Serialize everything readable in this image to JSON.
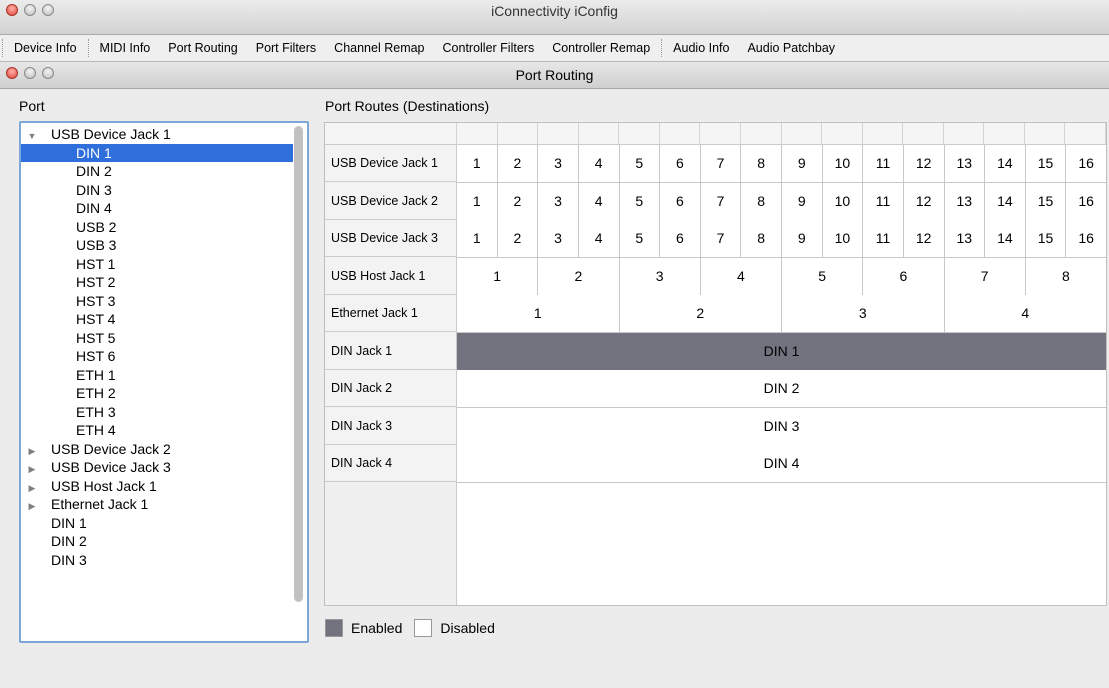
{
  "window": {
    "title": "iConnectivity iConfig"
  },
  "tabs": [
    "Device Info",
    "MIDI Info",
    "Port Routing",
    "Port Filters",
    "Channel Remap",
    "Controller Filters",
    "Controller Remap",
    "Audio Info",
    "Audio Patchbay"
  ],
  "subwindow": {
    "title": "Port Routing"
  },
  "port_panel": {
    "label": "Port",
    "items": [
      {
        "label": "USB Device Jack 1",
        "expand": "open",
        "indent": 0
      },
      {
        "label": "DIN 1",
        "indent": 1,
        "selected": true
      },
      {
        "label": "DIN 2",
        "indent": 1
      },
      {
        "label": "DIN 3",
        "indent": 1
      },
      {
        "label": "DIN 4",
        "indent": 1
      },
      {
        "label": "USB 2",
        "indent": 1
      },
      {
        "label": "USB 3",
        "indent": 1
      },
      {
        "label": "HST 1",
        "indent": 1
      },
      {
        "label": "HST 2",
        "indent": 1
      },
      {
        "label": "HST 3",
        "indent": 1
      },
      {
        "label": "HST 4",
        "indent": 1
      },
      {
        "label": "HST 5",
        "indent": 1
      },
      {
        "label": "HST 6",
        "indent": 1
      },
      {
        "label": "ETH 1",
        "indent": 1
      },
      {
        "label": "ETH 2",
        "indent": 1
      },
      {
        "label": "ETH 3",
        "indent": 1
      },
      {
        "label": "ETH 4",
        "indent": 1
      },
      {
        "label": "USB Device Jack 2",
        "expand": "closed",
        "indent": 0
      },
      {
        "label": "USB Device Jack 3",
        "expand": "closed",
        "indent": 0
      },
      {
        "label": "USB Host Jack 1",
        "expand": "closed",
        "indent": 0
      },
      {
        "label": "Ethernet Jack 1",
        "expand": "closed",
        "indent": 0
      },
      {
        "label": "DIN 1",
        "indent": 0
      },
      {
        "label": "DIN 2",
        "indent": 0
      },
      {
        "label": "DIN 3",
        "indent": 0
      }
    ]
  },
  "routes_panel": {
    "label": "Port Routes (Destinations)",
    "rows": [
      {
        "label": "USB Device Jack 1",
        "cells": [
          "1",
          "2",
          "3",
          "4",
          "5",
          "6",
          "7",
          "8",
          "9",
          "10",
          "11",
          "12",
          "13",
          "14",
          "15",
          "16"
        ],
        "enabled": []
      },
      {
        "label": "USB Device Jack 2",
        "cells": [
          "1",
          "2",
          "3",
          "4",
          "5",
          "6",
          "7",
          "8",
          "9",
          "10",
          "11",
          "12",
          "13",
          "14",
          "15",
          "16"
        ],
        "enabled": []
      },
      {
        "label": "USB Device Jack 3",
        "cells": [
          "1",
          "2",
          "3",
          "4",
          "5",
          "6",
          "7",
          "8",
          "9",
          "10",
          "11",
          "12",
          "13",
          "14",
          "15",
          "16"
        ],
        "enabled": []
      },
      {
        "label": "USB Host Jack 1",
        "cells": [
          "1",
          "2",
          "3",
          "4",
          "5",
          "6",
          "7",
          "8"
        ],
        "enabled": []
      },
      {
        "label": "Ethernet Jack 1",
        "cells": [
          "1",
          "2",
          "3",
          "4"
        ],
        "enabled": []
      },
      {
        "label": "DIN Jack 1",
        "cells": [
          "DIN 1"
        ],
        "enabled": [
          0
        ]
      },
      {
        "label": "DIN Jack 2",
        "cells": [
          "DIN 2"
        ],
        "enabled": []
      },
      {
        "label": "DIN Jack 3",
        "cells": [
          "DIN 3"
        ],
        "enabled": []
      },
      {
        "label": "DIN Jack 4",
        "cells": [
          "DIN 4"
        ],
        "enabled": []
      }
    ]
  },
  "legend": {
    "enabled": "Enabled",
    "disabled": "Disabled"
  },
  "colors": {
    "enabled": "#73737f",
    "selection": "#2f6fdb"
  }
}
